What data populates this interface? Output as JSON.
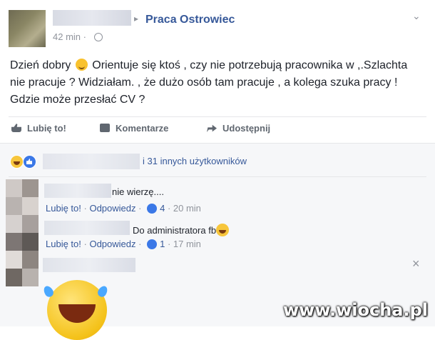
{
  "post": {
    "group_name": "Praca Ostrowiec",
    "separator": "▸",
    "time": "42 min ·",
    "text_part1": "Dzień dobry",
    "text_part2": "Orientuje się ktoś , czy nie potrzebują pracownika w ,.Szlachta nie pracuje ? Widziałam. , że dużo osób tam pracuje , a kolega szuka pracy ! Gdzie może przesłać CV ?",
    "menu_glyph": "⌄"
  },
  "actions": {
    "like": "Lubię to!",
    "comment": "Komentarze",
    "share": "Udostępnij"
  },
  "reactions": {
    "others_text": "i 31 innych użytkowników"
  },
  "comments": [
    {
      "text": "nie wierzę....",
      "like": "Lubię to!",
      "reply": "Odpowiedz",
      "likes": "4",
      "time": "20 min"
    },
    {
      "text": "Do administratora fb",
      "like": "Lubię to!",
      "reply": "Odpowiedz",
      "likes": "1",
      "time": "17 min"
    }
  ],
  "close_glyph": "×",
  "watermark": "www.wiocha.pl",
  "colors": {
    "link": "#365899",
    "muted": "#90949c",
    "like_blue": "#3b78e7",
    "emoji_yellow": "#f7c63c"
  }
}
